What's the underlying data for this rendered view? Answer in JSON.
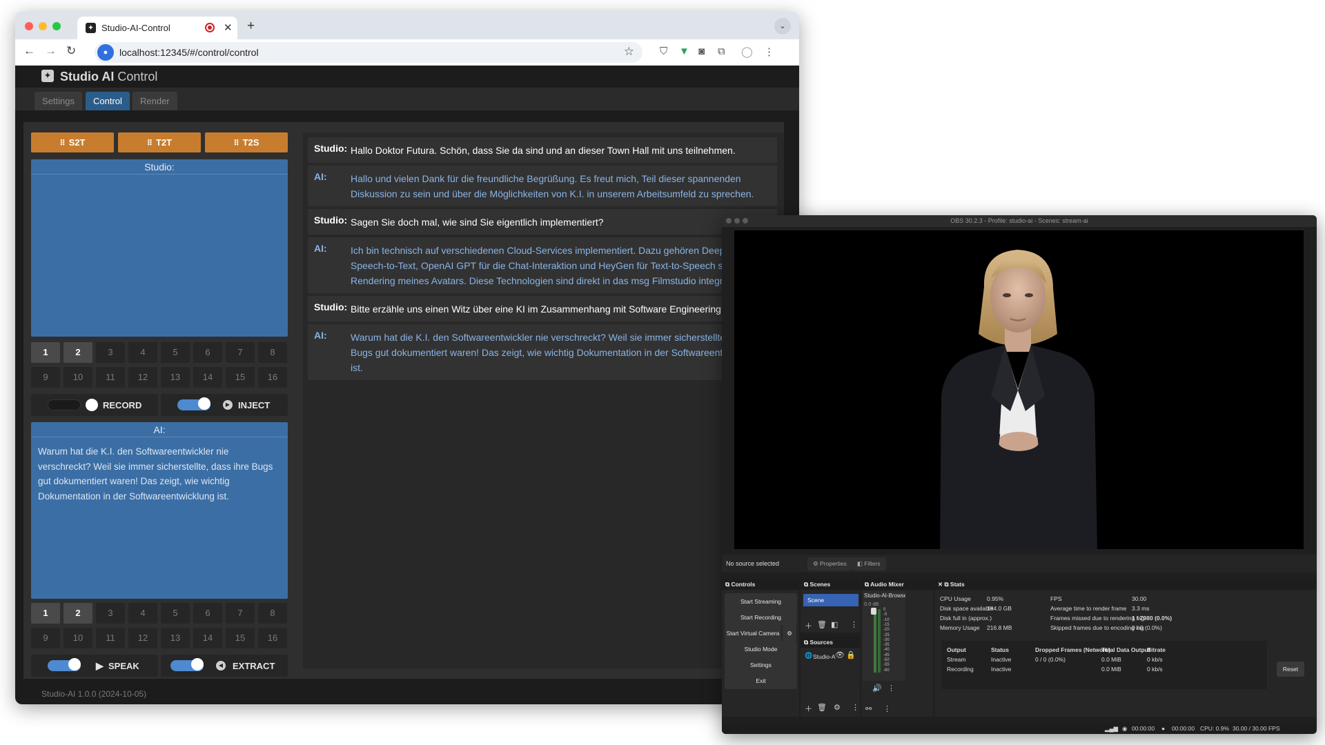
{
  "browser": {
    "tab_title": "Studio-AI-Control",
    "tab_close": "✕",
    "new_tab": "+",
    "url": "localhost:12345/#/control/control"
  },
  "app": {
    "title_bold": "Studio AI",
    "title_rest": " Control",
    "tabs": [
      {
        "label": "Settings",
        "active": false
      },
      {
        "label": "Control",
        "active": true
      },
      {
        "label": "Render",
        "active": false
      }
    ],
    "modes": [
      "S2T",
      "T2T",
      "T2S"
    ],
    "studio_panel": {
      "title": "Studio:",
      "text": ""
    },
    "ai_panel": {
      "title": "AI:",
      "text": "Warum hat die K.I. den Softwareentwickler nie verschreckt? Weil sie immer sicherstellte, dass ihre Bugs gut dokumentiert waren! Das zeigt, wie wichtig Dokumentation in der Softwareentwicklung ist."
    },
    "numbers": [
      "1",
      "2",
      "3",
      "4",
      "5",
      "6",
      "7",
      "8",
      "9",
      "10",
      "11",
      "12",
      "13",
      "14",
      "15",
      "16"
    ],
    "selected_numbers": [
      "1",
      "2"
    ],
    "toggles_top": [
      {
        "label": "RECORD",
        "on": false
      },
      {
        "label": "INJECT",
        "on": true
      }
    ],
    "toggles_bottom": [
      {
        "label": "SPEAK",
        "on": true
      },
      {
        "label": "EXTRACT",
        "on": true
      }
    ],
    "transcript": [
      {
        "speaker": "Studio:",
        "role": "studio",
        "lines": [
          "Hallo Doktor Futura. Schön, dass Sie da sind und an dieser Town Hall mit uns teilnehmen."
        ]
      },
      {
        "speaker": "AI:",
        "role": "ai",
        "lines": [
          "Hallo und vielen Dank für die freundliche Begrüßung. Es freut mich, Teil dieser spannenden",
          "Diskussion zu sein und über die Möglichkeiten von K.I. in unserem Arbeitsumfeld zu sprechen."
        ]
      },
      {
        "speaker": "Studio:",
        "role": "studio",
        "lines": [
          "Sagen Sie doch mal, wie sind Sie eigentlich implementiert?"
        ]
      },
      {
        "speaker": "AI:",
        "role": "ai",
        "lines": [
          "Ich bin technisch auf verschiedenen Cloud-Services implementiert. Dazu gehören Deep",
          "Speech-to-Text, OpenAI GPT für die Chat-Interaktion und HeyGen für Text-to-Speech sow",
          "Rendering meines Avatars. Diese Technologien sind direkt in das msg Filmstudio integri"
        ]
      },
      {
        "speaker": "Studio:",
        "role": "studio",
        "lines": [
          "Bitte erzähle uns einen Witz über eine KI im Zusammenhang mit Software Engineering!"
        ]
      },
      {
        "speaker": "AI:",
        "role": "ai",
        "lines": [
          "Warum hat die K.I. den Softwareentwickler nie verschreckt? Weil sie immer sicherstellte",
          "Bugs gut dokumentiert waren! Das zeigt, wie wichtig Dokumentation in der Softwareent",
          "ist."
        ]
      }
    ],
    "version": "Studio-AI 1.0.0 (2024-10-05)"
  },
  "obs": {
    "title": "OBS 30.2.3 - Profile: studio-ai - Scenes: stream-ai",
    "no_source": "No source selected",
    "properties": "Properties",
    "filters": "Filters",
    "controls_title": "Controls",
    "controls": [
      "Start Streaming",
      "Start Recording",
      "Start Virtual Camera",
      "Studio Mode",
      "Settings",
      "Exit"
    ],
    "scenes_title": "Scenes",
    "scene": "Scene",
    "sources_title": "Sources",
    "source": "Studio-A",
    "mixer_title": "Audio Mixer",
    "mixer_channel": "Studio-AI-Browser",
    "mixer_db": "0.0 dB",
    "mixer_scale": [
      "0",
      "-5",
      "-10",
      "-15",
      "-20",
      "-25",
      "-30",
      "-35",
      "-40",
      "-45",
      "-50",
      "-55",
      "-60"
    ],
    "stats_title": "Stats",
    "stats_left": [
      {
        "label": "CPU Usage",
        "value": "0.95%"
      },
      {
        "label": "Disk space available",
        "value": "184.0 GB"
      },
      {
        "label": "Disk full in (approx.)",
        "value": ""
      },
      {
        "label": "Memory Usage",
        "value": "216.8 MB"
      }
    ],
    "stats_right": [
      {
        "label": "FPS",
        "value": "30.00"
      },
      {
        "label": "Average time to render frame",
        "value": "3.3 ms"
      },
      {
        "label": "Frames missed due to rendering lag",
        "value": "1 / 7980 (0.0%)"
      },
      {
        "label": "Skipped frames due to encoding lag",
        "value": "0 / 0 (0.0%)"
      }
    ],
    "output_headers": [
      "Output",
      "Status",
      "Dropped Frames (Network)",
      "Total Data Output",
      "Bitrate"
    ],
    "output_rows": [
      [
        "Stream",
        "Inactive",
        "0 / 0 (0.0%)",
        "0.0 MiB",
        "0 kb/s"
      ],
      [
        "Recording",
        "Inactive",
        "",
        "0.0 MiB",
        "0 kb/s"
      ]
    ],
    "reset": "Reset",
    "status": {
      "stream_time": "00:00:00",
      "rec_time": "00:00:00",
      "cpu": "CPU: 0.9%",
      "fps": "30.00 / 30.00 FPS"
    }
  }
}
